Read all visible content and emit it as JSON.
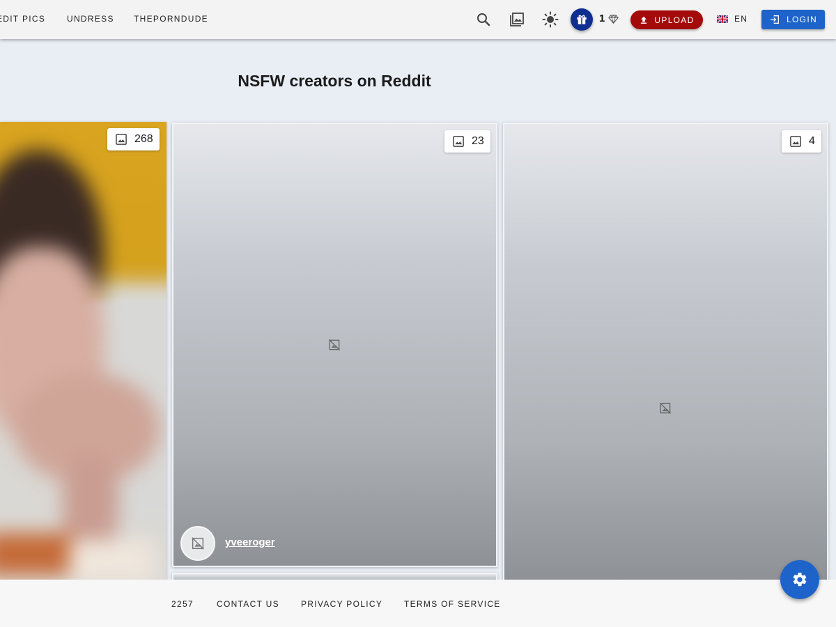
{
  "nav": {
    "items": [
      "EDIT PICS",
      "UNDRESS",
      "THEPORNDUDE"
    ]
  },
  "header": {
    "icons": [
      "search-icon",
      "gallery-icon",
      "brightness-icon",
      "gift-icon",
      "diamond-icon"
    ],
    "credits": "1",
    "upload_label": "UPLOAD",
    "language": "EN",
    "login_label": "LOGIN"
  },
  "page": {
    "title": "NSFW creators on Reddit"
  },
  "cards": [
    {
      "image_count": "268",
      "username": ""
    },
    {
      "image_count": "23",
      "username": "yveeroger"
    },
    {
      "image_count": "4",
      "username": ""
    }
  ],
  "footer": {
    "links": [
      "2257",
      "CONTACT US",
      "PRIVACY POLICY",
      "TERMS OF SERVICE"
    ]
  },
  "colors": {
    "accent_blue": "#1e63c9",
    "upload_red": "#a40a0a",
    "gift_navy": "#0e2f8f",
    "header_bg": "#f3f3f3",
    "page_bg": "#e9edf4"
  }
}
